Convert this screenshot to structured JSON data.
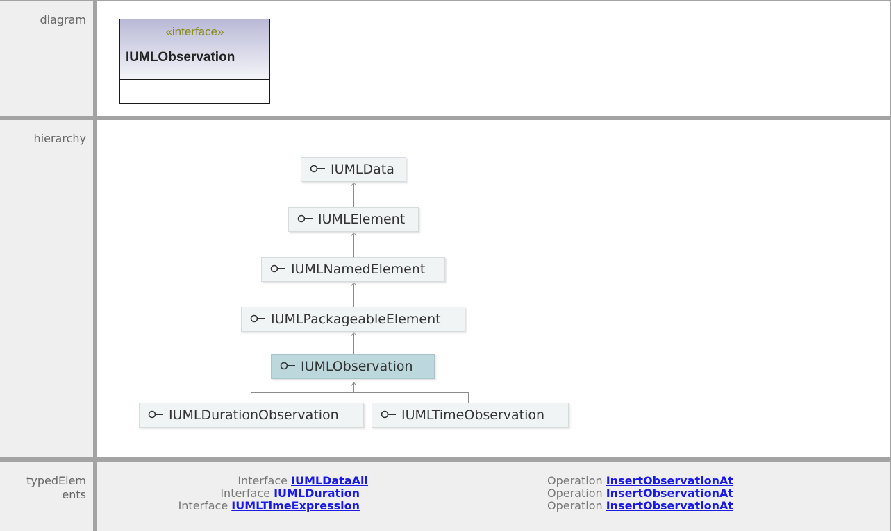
{
  "rows": {
    "diagram": {
      "label": "diagram"
    },
    "hierarchy": {
      "label": "hierarchy"
    },
    "typed": {
      "label_line1": "typedElem",
      "label_line2": "ents"
    }
  },
  "diagram": {
    "stereotype": "«interface»",
    "name": "IUMLObservation"
  },
  "hierarchy": {
    "nodes": [
      {
        "name": "IUMLData"
      },
      {
        "name": "IUMLElement"
      },
      {
        "name": "IUMLNamedElement"
      },
      {
        "name": "IUMLPackageableElement"
      },
      {
        "name": "IUMLObservation",
        "highlighted": true
      },
      {
        "name": "IUMLDurationObservation"
      },
      {
        "name": "IUMLTimeObservation"
      }
    ]
  },
  "typed_elements": {
    "left": [
      {
        "kind": "Interface",
        "name": "IUMLDataAll"
      },
      {
        "kind": "Interface",
        "name": "IUMLDuration"
      },
      {
        "kind": "Interface",
        "name": "IUMLTimeExpression"
      }
    ],
    "right": [
      {
        "kind": "Operation",
        "name": "InsertObservationAt"
      },
      {
        "kind": "Operation",
        "name": "InsertObservationAt"
      },
      {
        "kind": "Operation",
        "name": "InsertObservationAt"
      }
    ]
  },
  "colors": {
    "link": "#1a1ae6",
    "stereotype": "#8a8a1c",
    "node_highlight": "#bcd8dc",
    "node_bg": "#f0f4f4",
    "label_bg": "#efefef",
    "grid": "#a3a3a3"
  },
  "icons": {
    "node_icon": "interface-lollipop-icon",
    "arrow": "generalization-arrow-icon"
  }
}
